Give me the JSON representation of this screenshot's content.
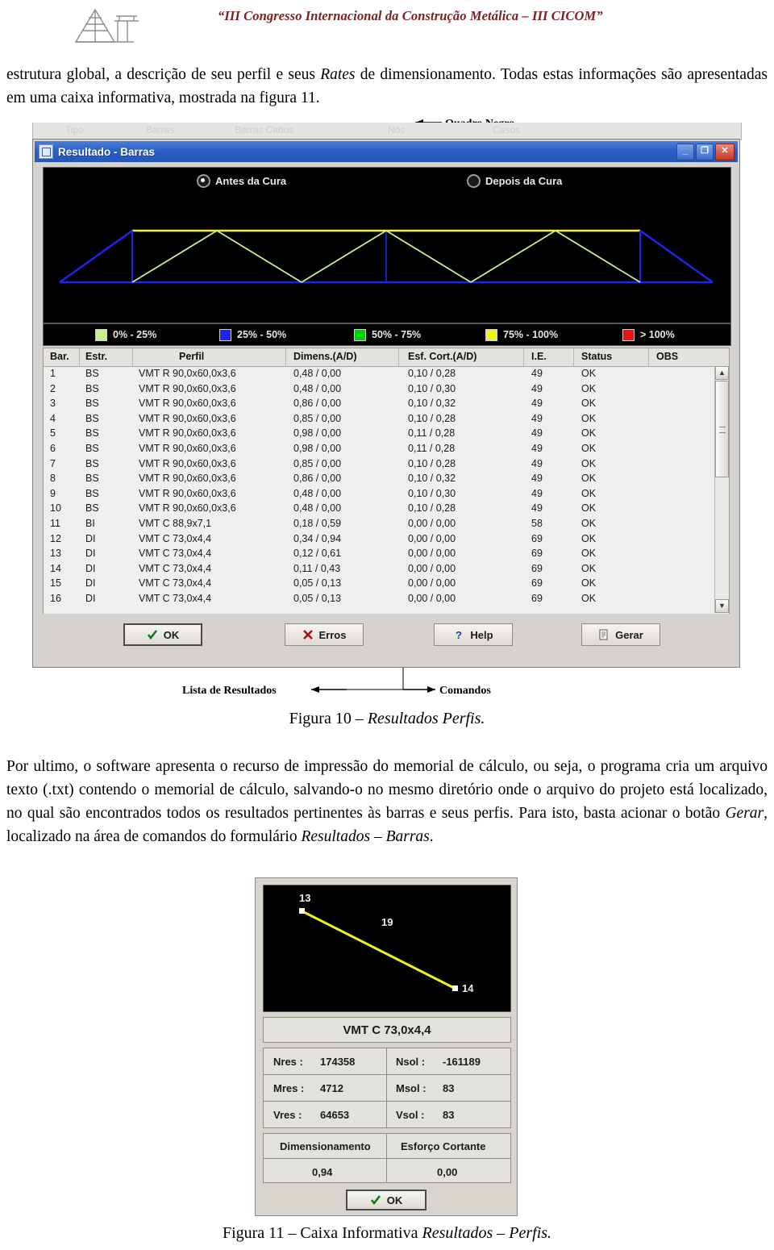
{
  "header": {
    "title": "“III Congresso Internacional da Construção Metálica – III CICOM”",
    "logo_icon": "bridge-truss-logo"
  },
  "paragraphs": {
    "top_part1": "estrutura global, a descrição de seu perfil e seus ",
    "top_italic": "Rates",
    "top_part2": " de dimensionamento. Todas estas informações são apresentadas em uma caixa informativa, mostrada na figura 11.",
    "bottom_part1": "Por ultimo, o software apresenta o recurso de impressão do memorial de cálculo, ou seja, o programa cria um arquivo texto (.txt) contendo o memorial de cálculo, salvando-o no mesmo diretório onde o arquivo do projeto está localizado, no qual são encontrados todos os resultados pertinentes às barras e seus perfis. Para isto, basta acionar o botão ",
    "bottom_italic1": "Gerar",
    "bottom_part2": ", localizado na área de comandos do formulário ",
    "bottom_italic2": "Resultados – Barras",
    "bottom_part3": "."
  },
  "captions": {
    "fig10_prefix": "Figura 10 ",
    "fig10_italic": "Resultados  Perfis.",
    "fig10_dash": "– ",
    "fig11_prefix": "Figura 11 – Caixa Informativa ",
    "fig11_italic": "Resultados – Perfis."
  },
  "callouts": {
    "quadro_negro": "Quadro Negro",
    "lista_resultados": "Lista de Resultados",
    "comandos": "Comandos"
  },
  "bg_strip": {
    "items": [
      "Tipo",
      "Barras",
      "Barras Cabos",
      "Nós",
      "Casos"
    ]
  },
  "window": {
    "title": "Resultado - Barras",
    "title_icon": "window-icon",
    "buttons": {
      "minimize": "_",
      "maximize": "❐",
      "close": "✕"
    },
    "radios": [
      {
        "label": "Antes da Cura",
        "selected": true
      },
      {
        "label": "Depois da Cura",
        "selected": false
      }
    ],
    "legend": [
      {
        "label": "0% - 25%",
        "color": "#c8f08a"
      },
      {
        "label": "25% - 50%",
        "color": "#2222ee"
      },
      {
        "label": "50% - 75%",
        "color": "#00d000"
      },
      {
        "label": "75% - 100%",
        "color": "#f2f21a"
      },
      {
        "label": "> 100%",
        "color": "#ee1111"
      }
    ],
    "table": {
      "headers": [
        "Bar.",
        "Estr.",
        "Perfil",
        "Dimens.(A/D)",
        "Esf. Cort.(A/D)",
        "I.E.",
        "Status",
        "OBS"
      ],
      "rows": [
        [
          "1",
          "BS",
          "VMT R 90,0x60,0x3,6",
          "0,48 / 0,00",
          "0,10 / 0,28",
          "49",
          "OK",
          ""
        ],
        [
          "2",
          "BS",
          "VMT R 90,0x60,0x3,6",
          "0,48 / 0,00",
          "0,10 / 0,30",
          "49",
          "OK",
          ""
        ],
        [
          "3",
          "BS",
          "VMT R 90,0x60,0x3,6",
          "0,86 / 0,00",
          "0,10 / 0,32",
          "49",
          "OK",
          ""
        ],
        [
          "4",
          "BS",
          "VMT R 90,0x60,0x3,6",
          "0,85 / 0,00",
          "0,10 / 0,28",
          "49",
          "OK",
          ""
        ],
        [
          "5",
          "BS",
          "VMT R 90,0x60,0x3,6",
          "0,98 / 0,00",
          "0,11 / 0,28",
          "49",
          "OK",
          ""
        ],
        [
          "6",
          "BS",
          "VMT R 90,0x60,0x3,6",
          "0,98 / 0,00",
          "0,11 / 0,28",
          "49",
          "OK",
          ""
        ],
        [
          "7",
          "BS",
          "VMT R 90,0x60,0x3,6",
          "0,85 / 0,00",
          "0,10 / 0,28",
          "49",
          "OK",
          ""
        ],
        [
          "8",
          "BS",
          "VMT R 90,0x60,0x3,6",
          "0,86 / 0,00",
          "0,10 / 0,32",
          "49",
          "OK",
          ""
        ],
        [
          "9",
          "BS",
          "VMT R 90,0x60,0x3,6",
          "0,48 / 0,00",
          "0,10 / 0,30",
          "49",
          "OK",
          ""
        ],
        [
          "10",
          "BS",
          "VMT R 90,0x60,0x3,6",
          "0,48 / 0,00",
          "0,10 / 0,28",
          "49",
          "OK",
          ""
        ],
        [
          "11",
          "BI",
          "VMT C 88,9x7,1",
          "0,18 / 0,59",
          "0,00 / 0,00",
          "58",
          "OK",
          ""
        ],
        [
          "12",
          "DI",
          "VMT C 73,0x4,4",
          "0,34 / 0,94",
          "0,00 / 0,00",
          "69",
          "OK",
          ""
        ],
        [
          "13",
          "DI",
          "VMT C 73,0x4,4",
          "0,12 / 0,61",
          "0,00 / 0,00",
          "69",
          "OK",
          ""
        ],
        [
          "14",
          "DI",
          "VMT C 73,0x4,4",
          "0,11 / 0,43",
          "0,00 / 0,00",
          "69",
          "OK",
          ""
        ],
        [
          "15",
          "DI",
          "VMT C 73,0x4,4",
          "0,05 / 0,13",
          "0,00 / 0,00",
          "69",
          "OK",
          ""
        ],
        [
          "16",
          "DI",
          "VMT C 73,0x4,4",
          "0,05 / 0,13",
          "0,00 / 0,00",
          "69",
          "OK",
          ""
        ]
      ]
    },
    "scrollbar": {
      "up": "▲",
      "down": "▼"
    },
    "buttons_row": [
      {
        "id": "ok",
        "label": "OK",
        "icon": "check-icon"
      },
      {
        "id": "erros",
        "label": "Erros",
        "icon": "x-icon"
      },
      {
        "id": "help",
        "label": "Help",
        "icon": "question-icon"
      },
      {
        "id": "gerar",
        "label": "Gerar",
        "icon": "document-icon"
      }
    ]
  },
  "infobox": {
    "node_labels": [
      "13",
      "19",
      "14"
    ],
    "profile": "VMT C 73,0x4,4",
    "values": [
      {
        "label": "Nres :",
        "value": "174358"
      },
      {
        "label": "Nsol : ",
        "value": "-161189"
      },
      {
        "label": "Mres :",
        "value": "4712"
      },
      {
        "label": "Msol :",
        "value": "83"
      },
      {
        "label": "Vres :",
        "value": "64653"
      },
      {
        "label": "Vsol :",
        "value": "83"
      }
    ],
    "grid2": {
      "headers": [
        "Dimensionamento",
        "Esforço Cortante"
      ],
      "values": [
        "0,94",
        "0,00"
      ]
    },
    "ok_label": "OK",
    "ok_icon": "check-icon"
  }
}
